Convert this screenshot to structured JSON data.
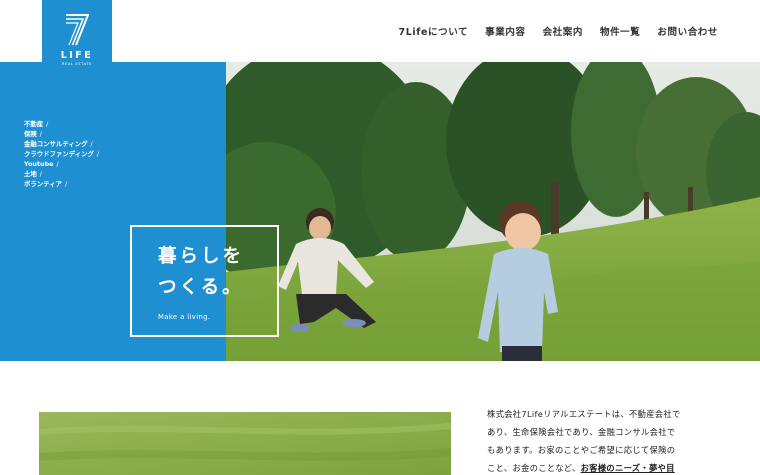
{
  "brand": {
    "mark": "7",
    "name": "LIFE",
    "subtitle": "REAL ESTATE",
    "color": "#1e8fd0"
  },
  "nav": [
    {
      "label": "7Lifeについて"
    },
    {
      "label": "事業内容"
    },
    {
      "label": "会社案内"
    },
    {
      "label": "物件一覧"
    },
    {
      "label": "お問い合わせ"
    }
  ],
  "categories": [
    {
      "label": "不動産",
      "sep": "/"
    },
    {
      "label": "保険",
      "sep": "/"
    },
    {
      "label": "金融コンサルティング",
      "sep": "/"
    },
    {
      "label": "クラウドファンディング",
      "sep": "/"
    },
    {
      "label": "Youtube",
      "sep": "/"
    },
    {
      "label": "土地",
      "sep": "/"
    },
    {
      "label": "ボランティア",
      "sep": "/"
    }
  ],
  "hero": {
    "tagline_line1": "暮らしを",
    "tagline_line2": "つくる。",
    "tagline_sub": "Make a living."
  },
  "intro": {
    "line1": "株式会社7Lifeリアルエステートは、不動産会社で",
    "line2": "あり、生命保険会社であり、金融コンサル会社で",
    "line3": "もあります。お家のことやご希望に応じて保険の",
    "line4_plain": "こと、お金のことなど、",
    "line4_emphasis": "お客様のニーズ・夢や目"
  }
}
